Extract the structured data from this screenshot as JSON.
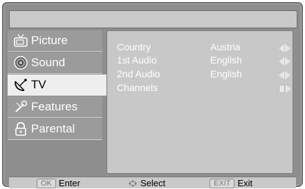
{
  "menu": {
    "items": [
      {
        "label": "Picture",
        "icon": "picture-tv-icon"
      },
      {
        "label": "Sound",
        "icon": "speaker-icon"
      },
      {
        "label": "TV",
        "icon": "satellite-dish-icon",
        "active": true
      },
      {
        "label": "Features",
        "icon": "tools-icon"
      },
      {
        "label": "Parental",
        "icon": "padlock-icon"
      }
    ]
  },
  "tv_settings": {
    "rows": [
      {
        "label": "Country",
        "value": "Austria",
        "control": "left-right-arrows"
      },
      {
        "label": "1st Audio",
        "value": "English",
        "control": "left-right-arrows"
      },
      {
        "label": "2nd Audio",
        "value": "English",
        "control": "left-right-arrows"
      },
      {
        "label": "Channels",
        "value": "",
        "control": "enter-arrow"
      }
    ]
  },
  "footer": {
    "enter_key": "OK",
    "enter_label": "Enter",
    "select_label": "Select",
    "exit_key": "EXIT",
    "exit_label": "Exit"
  },
  "colors": {
    "frame": "#8e8e8e",
    "menu_item": "#9b9b9b",
    "menu_active": "#eeeeee",
    "panel": "#c8c8c8",
    "footer": "#c9c9c9"
  }
}
